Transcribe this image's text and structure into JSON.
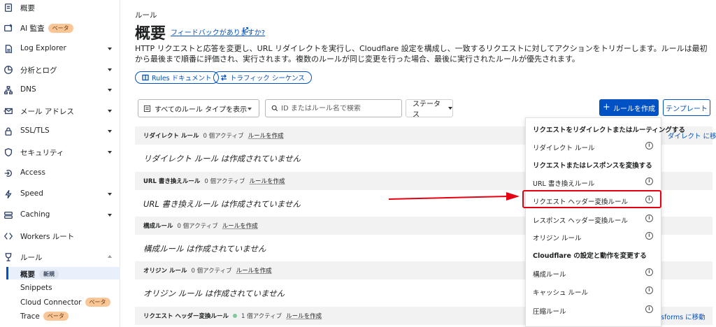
{
  "sidebar": {
    "items": [
      {
        "label": "概要",
        "icon": "document-icon"
      },
      {
        "label": "AI 監査",
        "badge": "ベータ",
        "icon": "ai-audit-icon"
      },
      {
        "label": "Log Explorer",
        "icon": "log-explorer-icon"
      },
      {
        "label": "分析とログ",
        "icon": "analytics-icon"
      },
      {
        "label": "DNS",
        "icon": "dns-icon"
      },
      {
        "label": "メール アドレス",
        "icon": "email-icon"
      },
      {
        "label": "SSL/TLS",
        "icon": "lock-icon"
      },
      {
        "label": "セキュリティ",
        "icon": "shield-icon"
      },
      {
        "label": "Access",
        "icon": "access-icon"
      },
      {
        "label": "Speed",
        "icon": "speed-icon"
      },
      {
        "label": "Caching",
        "icon": "caching-icon"
      },
      {
        "label": "Workers ルート",
        "icon": "workers-icon"
      },
      {
        "label": "ルール",
        "icon": "rules-icon"
      }
    ],
    "sub_items": [
      {
        "label": "概要",
        "badge": "新規"
      },
      {
        "label": "Snippets"
      },
      {
        "label": "Cloud Connector",
        "badge": "ベータ"
      },
      {
        "label": "Trace",
        "badge": "ベータ"
      }
    ]
  },
  "main": {
    "eyebrow": "ルール",
    "title": "概要",
    "feedback": "フィードバックがありますか?",
    "description": "HTTP リクエストと応答を変更し、URL リダイレクトを実行し、Cloudflare 設定を構成し、一致するリクエストに対してアクションをトリガーします。ルールは最初から最後まで順番に評価され、実行されます。複数のルールが同じ変更を行った場合、最後に実行されたルールが優先されます。",
    "pills": {
      "docs": "Rules ドキュメント",
      "trace": "トラフィック シーケンス"
    },
    "toolbar": {
      "rule_type_select": "すべてのルール タイプを表示",
      "search_placeholder": "ID またはルール名で検索",
      "status_select": "ステータス",
      "create_button": "ルールを作成",
      "template_button": "テンプレート"
    },
    "sections": [
      {
        "name": "リダイレクト ルール",
        "count": "0 個アクティブ",
        "create": "ルールを作成",
        "empty": "リダイレクト ルール は作成されていません",
        "link": "ダイレクト に移動"
      },
      {
        "name": "URL 書き換えルール",
        "count": "0 個アクティブ",
        "create": "ルールを作成",
        "empty": "URL 書き換えルール は作成されていません"
      },
      {
        "name": "構成ルール",
        "count": "0 個アクティブ",
        "create": "ルールを作成",
        "empty": "構成ルール は作成されていません"
      },
      {
        "name": "オリジン ルール",
        "count": "0 個アクティブ",
        "create": "ルールを作成",
        "empty": "オリジン ルール は作成されていません"
      },
      {
        "name": "リクエスト ヘッダー変換ルール",
        "count": "1 個アクティブ",
        "create": "ルールを作成",
        "link": "sforms に移動"
      }
    ]
  },
  "dropdown": {
    "groups": [
      {
        "title": "リクエストをリダイレクトまたはルーティングする",
        "items": [
          "リダイレクト ルール"
        ]
      },
      {
        "title": "リクエストまたはレスポンスを変換する",
        "items": [
          "URL 書き換えルール",
          "リクエスト ヘッダー変換ルール",
          "レスポンス ヘッダー変換ルール",
          "オリジン ルール"
        ]
      },
      {
        "title": "Cloudflare の設定と動作を変更する",
        "items": [
          "構成ルール",
          "キャッシュ ルール",
          "圧縮ルール"
        ]
      }
    ],
    "info_glyph": "i"
  },
  "colors": {
    "accent": "#0051c3",
    "highlight": "#e60012",
    "beta_badge": "#f8c697"
  }
}
